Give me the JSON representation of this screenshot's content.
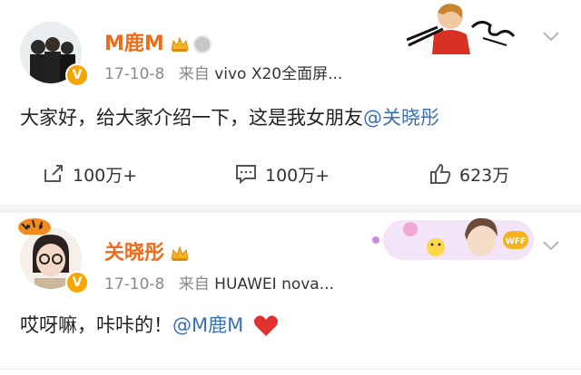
{
  "post1": {
    "author_name": "M鹿M",
    "timestamp": "17-10-8",
    "source_prefix": "来自",
    "source_device": "vivo X20全面屏...",
    "text_prefix": "大家好，给大家介绍一下，这是我女朋友",
    "mention": "@关晓彤",
    "actions": {
      "repost_count": "100万+",
      "comment_count": "100万+",
      "like_count": "623万"
    },
    "icons": {
      "repost": "repost-icon",
      "comment": "comment-icon",
      "like": "thumbs-up-icon",
      "more": "chevron-down-icon"
    }
  },
  "post2": {
    "author_name": "关晓彤",
    "timestamp": "17-10-8",
    "source_prefix": "来自",
    "source_device": "HUAWEI nova...",
    "text_prefix": "哎呀嘛，咔咔的！",
    "mention": "@M鹿M",
    "emoji": "heart"
  },
  "colors": {
    "name": "#ef6b19",
    "mention": "#3b6fb5",
    "verified": "#f7a600",
    "heart": "#e0312f"
  }
}
